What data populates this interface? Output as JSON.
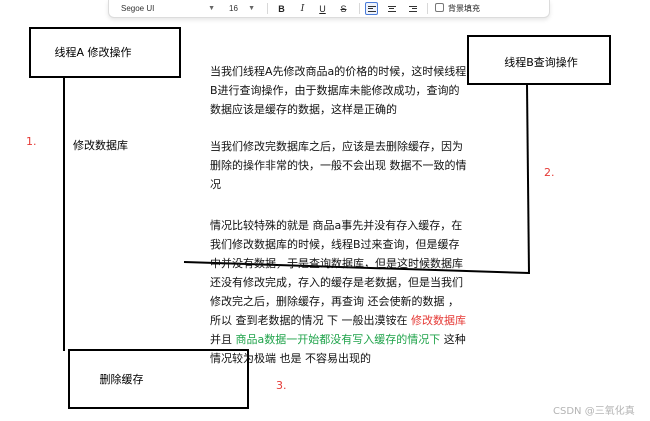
{
  "toolbar": {
    "font_family": "Segoe UI",
    "font_size": "16",
    "bold_label": "B",
    "italic_label": "I",
    "underline_label": "U",
    "strike_label": "S",
    "fill_checkbox_label": "背景填充",
    "active_alignment": "align-left"
  },
  "diagram": {
    "thread_a_box": "线程A 修改操作",
    "thread_b_box": "线程B查询操作",
    "modify_db_label": "修改数据库",
    "delete_cache_box": "删除缓存",
    "step1": "1.",
    "step2": "2.",
    "step3": "3."
  },
  "text": {
    "para1": "当我们线程A先修改商品a的价格的时候，这时候线程B进行查询操作，由于数据库未能修改成功，查询的数据应该是缓存的数据，这样是正确的",
    "para2": "当我们修改完数据库之后，应该是去删除缓存，因为删除的操作非常的快，一般不会出现 数据不一致的情况",
    "para3_a": "情况比较特殊的就是  商品a事先并没有存入缓存，在我们修改数据库的时候，线程B过来查询，但是缓存中并没有数据，于是查询数据库，但是这时候数据库还没有修改完成，存入的缓存是老数据，但是当我们修改完之后，删除缓存，再查询 还会使新的数据 ，所以 查到老数据的情况 下 一般出漠铵在   ",
    "para3_red": "修改数据库",
    "para3_b": "并且 ",
    "para3_green": "商品a数据一开始都没有写入缓存的情况下",
    "para3_c": " 这种情况较为极端 也是 不容易出现的"
  },
  "watermark": "CSDN @三氧化真",
  "colors": {
    "step_red": "#e53935",
    "highlight_red": "#e53935",
    "highlight_green": "#1fa34a",
    "stroke": "#000000",
    "watermark_gray": "#b4b4b4"
  }
}
